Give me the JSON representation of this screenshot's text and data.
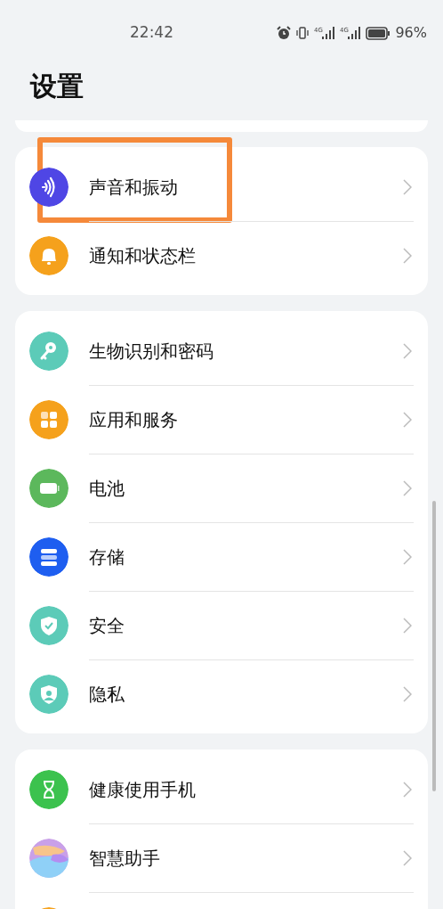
{
  "status_bar": {
    "time": "22:42",
    "networks": [
      "4G",
      "4G"
    ],
    "battery": "96%"
  },
  "title": "设置",
  "groups": [
    {
      "items": [
        {
          "label": "声音和振动",
          "color": "#4f46e5",
          "highlighted": true
        },
        {
          "label": "通知和状态栏",
          "color": "#f5a11c",
          "highlighted": false
        }
      ]
    },
    {
      "items": [
        {
          "label": "生物识别和密码",
          "color": "#5ccbb8",
          "highlighted": false
        },
        {
          "label": "应用和服务",
          "color": "#f5a11c",
          "highlighted": false
        },
        {
          "label": "电池",
          "color": "#5cb85c",
          "highlighted": false
        },
        {
          "label": "存储",
          "color": "#1e5ef0",
          "highlighted": false
        },
        {
          "label": "安全",
          "color": "#5ccbb8",
          "highlighted": false
        },
        {
          "label": "隐私",
          "color": "#5ccbb8",
          "highlighted": false
        }
      ]
    },
    {
      "items": [
        {
          "label": "健康使用手机",
          "color": "#3cc24e",
          "highlighted": false
        },
        {
          "label": "智慧助手",
          "color": "#c9a0e8",
          "highlighted": false
        },
        {
          "color": "#f5a11c",
          "highlighted": false
        }
      ]
    }
  ]
}
